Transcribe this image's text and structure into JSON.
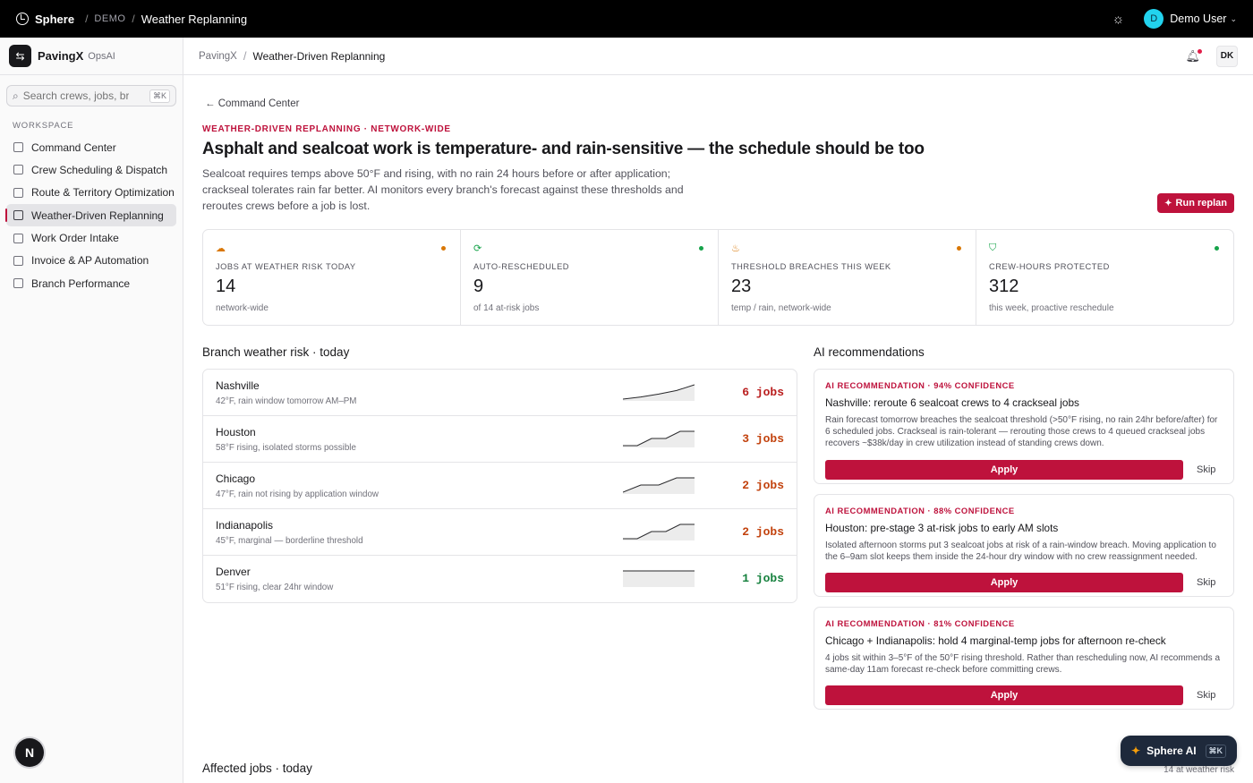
{
  "topbar": {
    "brand": "Sphere",
    "demo": "DEMO",
    "crumb": "Weather Replanning",
    "user_initial": "D",
    "user_name": "Demo User"
  },
  "sidebar": {
    "app_name": "PavingX",
    "app_sub": "OpsAI",
    "search_placeholder": "Search crews, jobs, br...",
    "search_kbd": "⌘K",
    "section": "WORKSPACE",
    "items": [
      {
        "label": "Command Center",
        "icon": "grid-icon"
      },
      {
        "label": "Crew Scheduling & Dispatch",
        "icon": "clipboard-icon"
      },
      {
        "label": "Route & Territory Optimization",
        "icon": "route-icon"
      },
      {
        "label": "Weather-Driven Replanning",
        "icon": "cloud-rain-icon"
      },
      {
        "label": "Work Order Intake",
        "icon": "inbox-icon"
      },
      {
        "label": "Invoice & AP Automation",
        "icon": "invoice-icon"
      },
      {
        "label": "Branch Performance",
        "icon": "bar-chart-icon"
      }
    ],
    "active_index": 3,
    "badge": "N"
  },
  "header": {
    "crumb_parent": "PavingX",
    "crumb_current": "Weather-Driven Replanning",
    "user_initials": "DK"
  },
  "page": {
    "back_label": "Command Center",
    "eyebrow": "WEATHER-DRIVEN REPLANNING · NETWORK-WIDE",
    "title": "Asphalt and sealcoat work is temperature- and rain-sensitive — the schedule should be too",
    "lede": "Sealcoat requires temps above 50°F and rising, with no rain 24 hours before or after application; crackseal tolerates rain far better. AI monitors every branch's forecast against these thresholds and reroutes crews before a job is lost.",
    "run_button": "Run replan"
  },
  "stats": [
    {
      "label": "JOBS AT WEATHER RISK TODAY",
      "value": "14",
      "sub": "network-wide",
      "icon": "cloud-rain-icon",
      "status": "#d97706"
    },
    {
      "label": "AUTO-RESCHEDULED",
      "value": "9",
      "sub": "of 14 at-risk jobs",
      "icon": "refresh-icon",
      "status": "#16a34a"
    },
    {
      "label": "THRESHOLD BREACHES THIS WEEK",
      "value": "23",
      "sub": "temp / rain, network-wide",
      "icon": "thermometer-icon",
      "status": "#d97706"
    },
    {
      "label": "CREW-HOURS PROTECTED",
      "value": "312",
      "sub": "this week, proactive reschedule",
      "icon": "shield-check-icon",
      "status": "#16a34a"
    }
  ],
  "branch_section_title": "Branch weather risk · today",
  "branches": [
    {
      "name": "Nashville",
      "detail": "42°F, rain window tomorrow AM–PM",
      "jobs": "6 jobs",
      "color": "#b91c1c",
      "trend": [
        0,
        0.15,
        0.35,
        0.6,
        1
      ]
    },
    {
      "name": "Houston",
      "detail": "58°F rising, isolated storms possible",
      "jobs": "3 jobs",
      "color": "#c2410c",
      "trend": [
        0,
        0,
        0.5,
        0.5,
        1,
        1
      ]
    },
    {
      "name": "Chicago",
      "detail": "47°F, rain not rising by application window",
      "jobs": "2 jobs",
      "color": "#c2410c",
      "trend": [
        0,
        0.5,
        0.5,
        1,
        1
      ]
    },
    {
      "name": "Indianapolis",
      "detail": "45°F, marginal — borderline threshold",
      "jobs": "2 jobs",
      "color": "#c2410c",
      "trend": [
        0,
        0,
        0.5,
        0.5,
        1,
        1
      ]
    },
    {
      "name": "Denver",
      "detail": "51°F rising, clear 24hr window",
      "jobs": "1 jobs",
      "color": "#15803d",
      "trend": [
        1,
        1,
        1,
        1,
        1
      ]
    }
  ],
  "recs_section_title": "AI recommendations",
  "recommendations": [
    {
      "confidence": "AI RECOMMENDATION · 94% CONFIDENCE",
      "title": "Nashville: reroute 6 sealcoat crews to 4 crackseal jobs",
      "body": "Rain forecast tomorrow breaches the sealcoat threshold (>50°F rising, no rain 24hr before/after) for 6 scheduled jobs. Crackseal is rain-tolerant — rerouting those crews to 4 queued crackseal jobs recovers ~$38k/day in crew utilization instead of standing crews down.",
      "apply": "Apply",
      "skip": "Skip"
    },
    {
      "confidence": "AI RECOMMENDATION · 88% CONFIDENCE",
      "title": "Houston: pre-stage 3 at-risk jobs to early AM slots",
      "body": "Isolated afternoon storms put 3 sealcoat jobs at risk of a rain-window breach. Moving application to the 6–9am slot keeps them inside the 24-hour dry window with no crew reassignment needed.",
      "apply": "Apply",
      "skip": "Skip"
    },
    {
      "confidence": "AI RECOMMENDATION · 81% CONFIDENCE",
      "title": "Chicago + Indianapolis: hold 4 marginal-temp jobs for afternoon re-check",
      "body": "4 jobs sit within 3–5°F of the 50°F rising threshold. Rather than rescheduling now, AI recommends a same-day 11am forecast re-check before committing crews.",
      "apply": "Apply",
      "skip": "Skip"
    }
  ],
  "affected_title": "Affected jobs · today",
  "affected_meta": "14 at weather risk",
  "sphere_ai": {
    "label": "Sphere AI",
    "kbd": "⌘K"
  }
}
